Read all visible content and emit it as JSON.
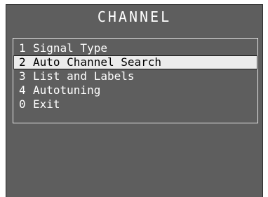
{
  "menu": {
    "title": "CHANNEL",
    "items": [
      {
        "number": "1",
        "label": "Signal Type",
        "selected": false
      },
      {
        "number": "2",
        "label": "Auto Channel Search",
        "selected": true
      },
      {
        "number": "3",
        "label": "List and Labels",
        "selected": false
      },
      {
        "number": "4",
        "label": "Autotuning",
        "selected": false
      },
      {
        "number": "0",
        "label": "Exit",
        "selected": false
      }
    ]
  },
  "colors": {
    "background": "#5e5e5e",
    "text": "#ffffff",
    "highlight": "#ebebeb",
    "highlight_text": "#000000"
  }
}
